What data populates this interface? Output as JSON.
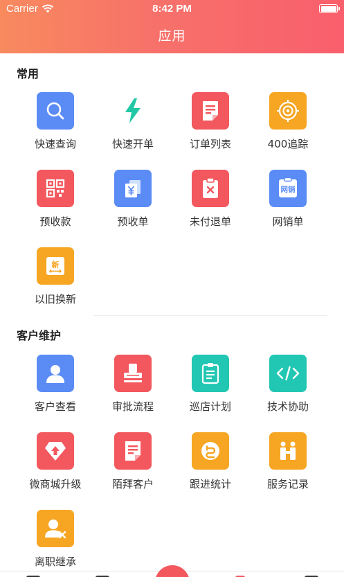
{
  "status": {
    "carrier": "Carrier",
    "time": "8:42 PM"
  },
  "header": {
    "title": "应用"
  },
  "sections": [
    {
      "title": "常用",
      "items": [
        {
          "label": "快速查询",
          "icon": "search-icon",
          "color": "#5b8cf6"
        },
        {
          "label": "快速开单",
          "icon": "lightning-icon",
          "color": "#22c7a5"
        },
        {
          "label": "订单列表",
          "icon": "document-icon",
          "color": "#f2585e"
        },
        {
          "label": "400追踪",
          "icon": "target-icon",
          "color": "#f6a623"
        },
        {
          "label": "预收款",
          "icon": "qrcode-icon",
          "color": "#f2585e"
        },
        {
          "label": "预收单",
          "icon": "yuan-cards-icon",
          "color": "#5b8cf6"
        },
        {
          "label": "未付退单",
          "icon": "clipboard-x-icon",
          "color": "#f2585e"
        },
        {
          "label": "网销单",
          "icon": "online-sale-icon",
          "color": "#5b8cf6",
          "badge": "网销"
        },
        {
          "label": "以旧换新",
          "icon": "trade-in-icon",
          "color": "#f6a623",
          "badge": "新"
        }
      ]
    },
    {
      "title": "客户维护",
      "items": [
        {
          "label": "客户查看",
          "icon": "user-icon",
          "color": "#5b8cf6"
        },
        {
          "label": "审批流程",
          "icon": "stamp-icon",
          "color": "#f2585e"
        },
        {
          "label": "巡店计划",
          "icon": "checklist-icon",
          "color": "#22c7b3"
        },
        {
          "label": "技术协助",
          "icon": "code-icon",
          "color": "#22c7b3"
        },
        {
          "label": "微商城升级",
          "icon": "shop-upgrade-icon",
          "color": "#f2585e"
        },
        {
          "label": "陌拜客户",
          "icon": "visit-doc-icon",
          "color": "#f2585e"
        },
        {
          "label": "跟进统计",
          "icon": "follow-up-icon",
          "color": "#f6a623"
        },
        {
          "label": "服务记录",
          "icon": "service-icon",
          "color": "#f6a623"
        },
        {
          "label": "离职继承",
          "icon": "user-remove-icon",
          "color": "#f6a623"
        }
      ]
    }
  ],
  "colors": {
    "header_start": "#f88a5e",
    "header_end": "#f95f6c",
    "accent": "#f2585e"
  }
}
